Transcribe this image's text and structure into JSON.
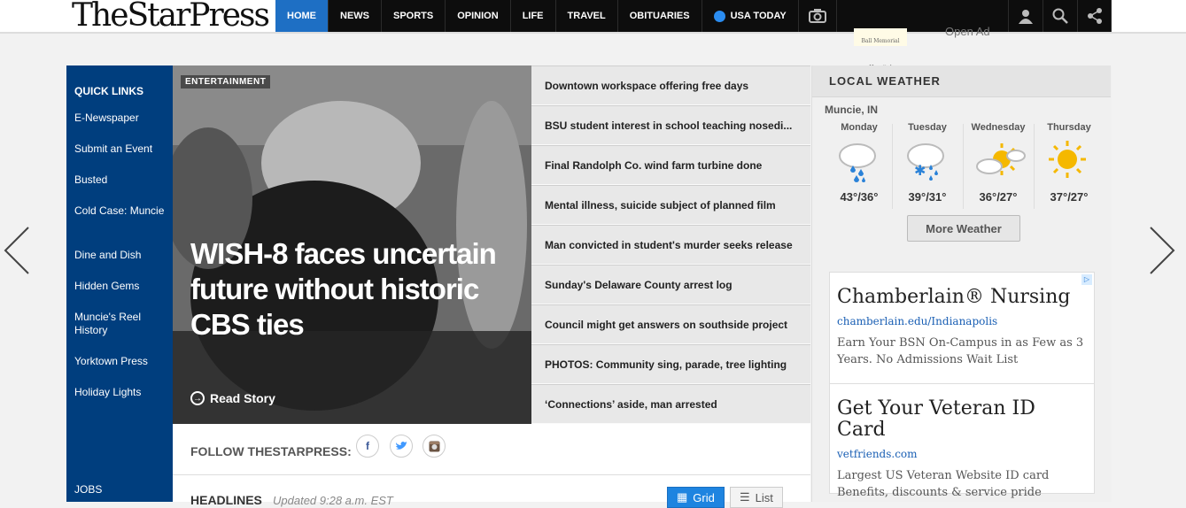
{
  "header": {
    "logo": "TheStarPress",
    "nav": [
      "HOME",
      "NEWS",
      "SPORTS",
      "OPINION",
      "LIFE",
      "TRAVEL",
      "OBITUARIES",
      "USA TODAY"
    ],
    "ad_label": "Open Ad",
    "hospital_label": "Ball Memorial Hospital"
  },
  "quick_links": {
    "title": "QUICK LINKS",
    "items": [
      "E-Newspaper",
      "Submit an Event",
      "Busted",
      "Cold Case: Muncie",
      "Dine and Dish",
      "Hidden Gems",
      "Muncie's Reel History",
      "Yorktown Press",
      "Holiday Lights"
    ],
    "jobs": "JOBS"
  },
  "hero": {
    "tag": "ENTERTAINMENT",
    "title": "WISH-8 faces uncertain future without historic CBS ties",
    "read_story": "Read Story"
  },
  "headlines_list": [
    "Downtown workspace offering free days",
    "BSU student interest in school teaching nosedi...",
    "Final Randolph Co. wind farm turbine done",
    "Mental illness, suicide subject of planned film",
    "Man convicted in student's murder seeks release",
    "Sunday's Delaware County arrest log",
    "Council might get answers on southside project",
    "PHOTOS: Community sing, parade, tree lighting",
    "‘Connections’ aside, man arrested"
  ],
  "follow": {
    "label": "FOLLOW THESTARPRESS:",
    "facebook": "f",
    "twitter": "t"
  },
  "headlines": {
    "title": "HEADLINES",
    "updated": "Updated 9:28 a.m. EST",
    "grid": "Grid",
    "list": "List"
  },
  "weather": {
    "title": "LOCAL WEATHER",
    "location": "Muncie, IN",
    "days": [
      {
        "day": "Monday",
        "temp": "43°/36°",
        "icon": "rain-icon"
      },
      {
        "day": "Tuesday",
        "temp": "39°/31°",
        "icon": "snow-rain-icon"
      },
      {
        "day": "Wednesday",
        "temp": "36°/27°",
        "icon": "partly-sunny-icon"
      },
      {
        "day": "Thursday",
        "temp": "37°/27°",
        "icon": "sunny-icon"
      }
    ],
    "more": "More Weather"
  },
  "ads": [
    {
      "title": "Chamberlain® Nursing",
      "url": "chamberlain.edu/Indianapolis",
      "desc": "Earn Your BSN On-Campus in as Few as 3 Years. No Admissions Wait List"
    },
    {
      "title": "Get Your Veteran ID Card",
      "url": "vetfriends.com",
      "desc": "Largest US Veteran Website ID card Benefits, discounts & service pride"
    }
  ],
  "colors": {
    "brand_blue": "#003e7e",
    "nav_active": "#1e6fc4"
  }
}
